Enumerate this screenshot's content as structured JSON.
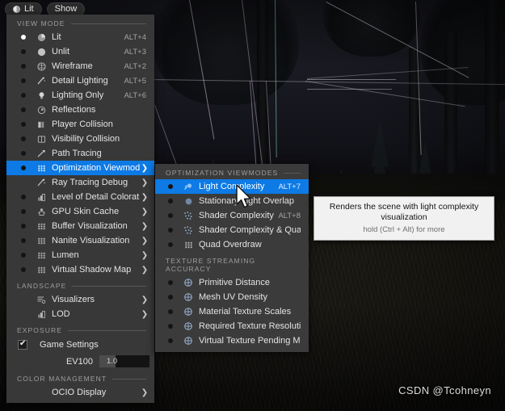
{
  "topbar": {
    "lit_button": "Lit",
    "show_button": "Show"
  },
  "viewmode_menu": {
    "sections": [
      {
        "name": "VIEW MODE",
        "header": "VIEW MODE",
        "items": [
          {
            "label": "Lit",
            "shortcut": "ALT+4",
            "icon": "half-sphere-icon",
            "selected_radio": true,
            "submenu": false
          },
          {
            "label": "Unlit",
            "shortcut": "ALT+3",
            "icon": "sphere-icon",
            "selected_radio": false,
            "submenu": false
          },
          {
            "label": "Wireframe",
            "shortcut": "ALT+2",
            "icon": "wireframe-sphere-icon",
            "selected_radio": false,
            "submenu": false
          },
          {
            "label": "Detail Lighting",
            "shortcut": "ALT+5",
            "icon": "detail-lighting-icon",
            "selected_radio": false,
            "submenu": false
          },
          {
            "label": "Lighting Only",
            "shortcut": "ALT+6",
            "icon": "bulb-icon",
            "selected_radio": false,
            "submenu": false
          },
          {
            "label": "Reflections",
            "shortcut": "",
            "icon": "reflections-icon",
            "selected_radio": false,
            "submenu": false
          },
          {
            "label": "Player Collision",
            "shortcut": "",
            "icon": "player-collision-icon",
            "selected_radio": false,
            "submenu": false
          },
          {
            "label": "Visibility Collision",
            "shortcut": "",
            "icon": "visibility-collision-icon",
            "selected_radio": false,
            "submenu": false
          },
          {
            "label": "Path Tracing",
            "shortcut": "",
            "icon": "path-tracing-icon",
            "selected_radio": false,
            "submenu": false
          },
          {
            "label": "Optimization Viewmodes",
            "shortcut": "",
            "icon": "grid-icon",
            "selected_radio": false,
            "submenu": true,
            "highlighted": true
          },
          {
            "label": "Ray Tracing Debug",
            "shortcut": "",
            "icon": "ray-tracing-icon",
            "selected_radio": false,
            "submenu": true,
            "no_radio": true
          },
          {
            "label": "Level of Detail Coloration",
            "shortcut": "",
            "icon": "lod-icon",
            "selected_radio": false,
            "submenu": true
          },
          {
            "label": "GPU Skin Cache",
            "shortcut": "",
            "icon": "gpu-skin-icon",
            "selected_radio": false,
            "submenu": true
          },
          {
            "label": "Buffer Visualization",
            "shortcut": "",
            "icon": "grid-icon",
            "selected_radio": false,
            "submenu": true
          },
          {
            "label": "Nanite Visualization",
            "shortcut": "",
            "icon": "grid-icon",
            "selected_radio": false,
            "submenu": true
          },
          {
            "label": "Lumen",
            "shortcut": "",
            "icon": "grid-icon",
            "selected_radio": false,
            "submenu": true
          },
          {
            "label": "Virtual Shadow Map",
            "shortcut": "",
            "icon": "grid-icon",
            "selected_radio": false,
            "submenu": true
          }
        ]
      },
      {
        "name": "LANDSCAPE",
        "header": "LANDSCAPE",
        "items": [
          {
            "label": "Visualizers",
            "shortcut": "",
            "icon": "visualizers-icon",
            "selected_radio": false,
            "submenu": true,
            "no_radio": true
          },
          {
            "label": "LOD",
            "shortcut": "",
            "icon": "lod-icon",
            "selected_radio": false,
            "submenu": true,
            "no_radio": true
          }
        ]
      }
    ],
    "exposure": {
      "header": "EXPOSURE",
      "game_settings_label": "Game Settings",
      "game_settings_checked": true,
      "ev100_label": "EV100",
      "ev100_value": "1.0",
      "ev100_fill_percent": 33
    },
    "color_management": {
      "header": "COLOR MANAGEMENT",
      "ocio_label": "OCIO Display",
      "ocio_submenu": true
    }
  },
  "optimization_submenu": {
    "sections": [
      {
        "header": "OPTIMIZATION VIEWMODES",
        "items": [
          {
            "label": "Light Complexity",
            "shortcut": "ALT+7",
            "icon": "light-complexity-icon",
            "highlighted": true
          },
          {
            "label": "Stationary Light Overlap",
            "shortcut": "",
            "icon": "stationary-light-icon",
            "highlighted": false
          },
          {
            "label": "Shader Complexity",
            "shortcut": "ALT+8",
            "icon": "shader-complexity-icon",
            "highlighted": false
          },
          {
            "label": "Shader Complexity & Quads",
            "shortcut": "",
            "icon": "shader-quads-icon",
            "highlighted": false
          },
          {
            "label": "Quad Overdraw",
            "shortcut": "",
            "icon": "quad-overdraw-icon",
            "highlighted": false
          }
        ]
      },
      {
        "header": "TEXTURE STREAMING ACCURACY",
        "items": [
          {
            "label": "Primitive Distance",
            "shortcut": "",
            "icon": "globe-icon",
            "highlighted": false
          },
          {
            "label": "Mesh UV Density",
            "shortcut": "",
            "icon": "globe-icon",
            "highlighted": false
          },
          {
            "label": "Material Texture Scales",
            "shortcut": "",
            "icon": "globe-icon",
            "highlighted": false
          },
          {
            "label": "Required Texture Resolution",
            "shortcut": "",
            "icon": "globe-icon",
            "highlighted": false
          },
          {
            "label": "Virtual Texture Pending Mips",
            "shortcut": "",
            "icon": "globe-icon",
            "highlighted": false
          }
        ]
      }
    ]
  },
  "tooltip": {
    "title": "Renders the scene with light complexity visualization",
    "hint": "hold (Ctrl + Alt) for more"
  },
  "watermark": "CSDN @Tcohneyn",
  "colors": {
    "menu_background": "#383838",
    "submenu_background": "#3b3b3b",
    "highlight": "#0d7ae5",
    "text": "#e3e3e3",
    "section_header": "#9e9e9e",
    "tooltip_background": "#f1f1f1"
  }
}
